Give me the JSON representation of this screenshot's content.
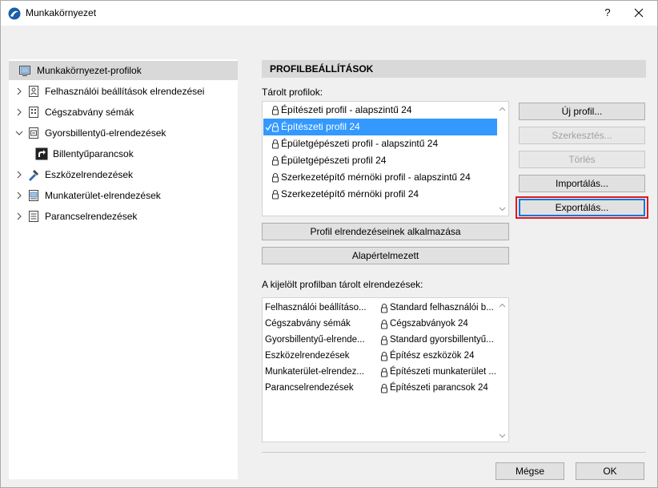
{
  "window": {
    "title": "Munkakörnyezet",
    "help_label": "?"
  },
  "tree": {
    "items": [
      {
        "label": "Munkakörnyezet-profilok",
        "expandable": false,
        "selected": true
      },
      {
        "label": "Felhasználói beállítások elrendezései",
        "expandable": true,
        "expanded": false
      },
      {
        "label": "Cégszabvány sémák",
        "expandable": true,
        "expanded": false
      },
      {
        "label": "Gyorsbillentyű-elrendezések",
        "expandable": true,
        "expanded": true
      },
      {
        "label": "Billentyűparancsok",
        "expandable": false,
        "child": true
      },
      {
        "label": "Eszközelrendezések",
        "expandable": true,
        "expanded": false
      },
      {
        "label": "Munkaterület-elrendezések",
        "expandable": true,
        "expanded": false
      },
      {
        "label": "Parancselrendezések",
        "expandable": true,
        "expanded": false
      }
    ]
  },
  "main": {
    "header": "PROFILBEÁLLÍTÁSOK",
    "stored_profiles_label": "Tárolt profilok:",
    "profiles": [
      {
        "label": "Építészeti profil - alapszintű 24",
        "selected": false
      },
      {
        "label": "Építészeti profil 24",
        "selected": true
      },
      {
        "label": "Épületgépészeti profil - alapszintű 24",
        "selected": false
      },
      {
        "label": "Épületgépészeti profil 24",
        "selected": false
      },
      {
        "label": "Szerkezetépítő mérnöki profil - alapszintű 24",
        "selected": false
      },
      {
        "label": "Szerkezetépítő mérnöki profil 24",
        "selected": false
      }
    ],
    "buttons": {
      "new": "Új profil...",
      "edit": "Szerkesztés...",
      "delete": "Törlés",
      "import": "Importálás...",
      "export": "Exportálás...",
      "apply": "Profil elrendezéseinek alkalmazása",
      "default": "Alapértelmezett"
    },
    "layouts_label": "A kijelölt profilban tárolt elrendezések:",
    "layouts": [
      {
        "name": "Felhasználói beállításo...",
        "value": "Standard felhasználói b..."
      },
      {
        "name": "Cégszabvány sémák",
        "value": "Cégszabványok 24"
      },
      {
        "name": "Gyorsbillentyű-elrende...",
        "value": "Standard gyorsbillentyű..."
      },
      {
        "name": "Eszközelrendezések",
        "value": "Építész eszközök 24"
      },
      {
        "name": "Munkaterület-elrendez...",
        "value": "Építészeti munkaterület ..."
      },
      {
        "name": "Parancselrendezések",
        "value": "Építészeti parancsok 24"
      }
    ]
  },
  "footer": {
    "cancel": "Mégse",
    "ok": "OK"
  },
  "colors": {
    "selection": "#3399ff",
    "highlight": "#e0181f",
    "panel": "#f0f0f0"
  }
}
